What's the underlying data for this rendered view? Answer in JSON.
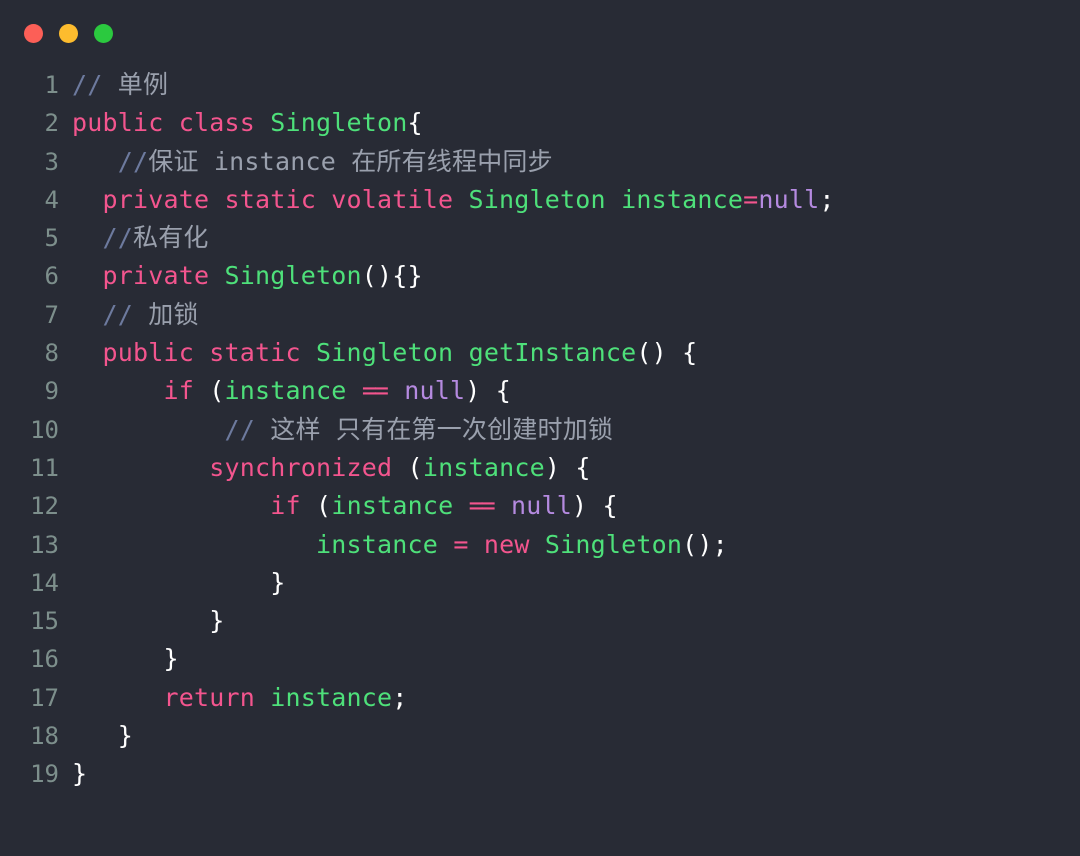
{
  "window": {
    "titlebar": {
      "controls": [
        {
          "name": "close-button",
          "color": "#fc5f57"
        },
        {
          "name": "minimize-button",
          "color": "#fdbc2e"
        },
        {
          "name": "maximize-button",
          "color": "#2bc93f"
        }
      ]
    },
    "background_color": "#282b35"
  },
  "editor": {
    "language": "Java",
    "line_count": 19,
    "gutter_color": "#7d8f8c",
    "theme_colors": {
      "background": "#282b35",
      "keyword": "#f3558e",
      "type": "#4ee07a",
      "variable": "#4ee07a",
      "constant": "#b58ae0",
      "punctuation": "#ffffff",
      "comment": "#9aa0ad",
      "comment_slashes": "#6d7a9e",
      "operator": "#f3558e"
    },
    "lines": [
      {
        "n": "1",
        "text": "// 单例"
      },
      {
        "n": "2",
        "text": "public class Singleton{"
      },
      {
        "n": "3",
        "text": "    //保证 instance 在所有线程中同步"
      },
      {
        "n": "4",
        "text": "   private static volatile Singleton instance=null;"
      },
      {
        "n": "5",
        "text": "   //私有化"
      },
      {
        "n": "6",
        "text": "   private Singleton(){}"
      },
      {
        "n": "7",
        "text": "   // 加锁"
      },
      {
        "n": "8",
        "text": "   public static Singleton getInstance() {"
      },
      {
        "n": "9",
        "text": "       if (instance == null) {"
      },
      {
        "n": "10",
        "text": "           // 这样 只有在第一次创建时加锁"
      },
      {
        "n": "11",
        "text": "           synchronized (instance) {"
      },
      {
        "n": "12",
        "text": "               if (instance == null) {"
      },
      {
        "n": "13",
        "text": "                   instance = new Singleton();"
      },
      {
        "n": "14",
        "text": "               }"
      },
      {
        "n": "15",
        "text": "           }"
      },
      {
        "n": "16",
        "text": "       }"
      },
      {
        "n": "17",
        "text": "       return instance;"
      },
      {
        "n": "18",
        "text": "   }"
      },
      {
        "n": "19",
        "text": "}"
      }
    ]
  },
  "code_text": "// 单例\npublic class Singleton{\n    //保证 instance 在所有线程中同步\n   private static volatile Singleton instance=null;\n   //私有化\n   private Singleton(){}\n   // 加锁\n   public static Singleton getInstance() {\n       if (instance == null) {\n           // 这样 只有在第一次创建时加锁\n           synchronized (instance) {\n               if (instance == null) {\n                   instance = new Singleton();\n               }\n           }\n       }\n       return instance;\n   }\n}"
}
